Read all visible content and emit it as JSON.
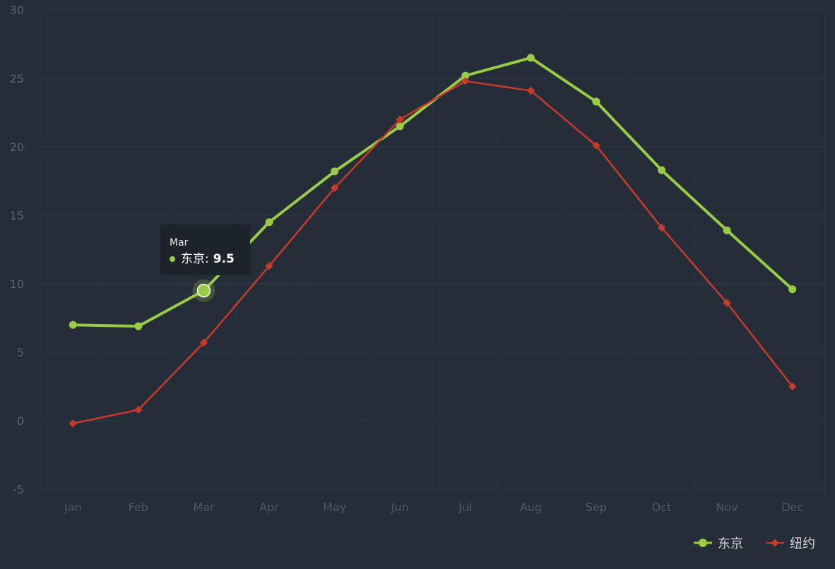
{
  "chart_data": {
    "type": "line",
    "categories": [
      "Jan",
      "Feb",
      "Mar",
      "Apr",
      "May",
      "Jun",
      "Jul",
      "Aug",
      "Sep",
      "Oct",
      "Nov",
      "Dec"
    ],
    "series": [
      {
        "name": "东京",
        "color": "#99cc44",
        "marker": "circle",
        "values": [
          7.0,
          6.9,
          9.5,
          14.5,
          18.2,
          21.5,
          25.2,
          26.5,
          23.3,
          18.3,
          13.9,
          9.6
        ]
      },
      {
        "name": "纽约",
        "color": "#c8392b",
        "marker": "diamond",
        "values": [
          -0.2,
          0.8,
          5.7,
          11.3,
          17.0,
          22.0,
          24.8,
          24.1,
          20.1,
          14.1,
          8.6,
          2.5
        ]
      }
    ],
    "ylim": [
      -5,
      30
    ],
    "yticks": [
      -5,
      0,
      5,
      10,
      15,
      20,
      25,
      30
    ],
    "grid": true,
    "legend_position": "bottom-right"
  },
  "tooltip": {
    "title": "Mar",
    "series_name": "东京",
    "value": "9.5",
    "color": "#99cc44"
  },
  "legend": [
    {
      "name": "东京",
      "color": "#99cc44",
      "marker": "circle"
    },
    {
      "name": "纽约",
      "color": "#c8392b",
      "marker": "diamond"
    }
  ]
}
